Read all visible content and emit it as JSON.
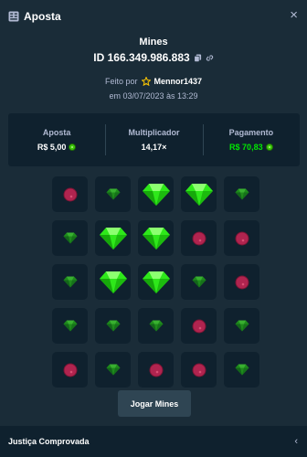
{
  "header": {
    "title": "Aposta",
    "close_label": "×"
  },
  "bet": {
    "game": "Mines",
    "id": "ID 166.349.986.883",
    "made_by_prefix": "Feito por",
    "user": "Mennor1437",
    "date": "em 03/07/2023 às 13:29"
  },
  "stats": {
    "bet_label": "Aposta",
    "bet_value": "R$ 5,00",
    "multiplier_label": "Multiplicador",
    "multiplier_value": "14,17×",
    "payout_label": "Pagamento",
    "payout_value": "R$ 70,83"
  },
  "colors": {
    "accent_green": "#00e701",
    "bg": "#1a2c38",
    "panel": "#0f212e",
    "mine": "#b0244f"
  },
  "board": [
    [
      "mine",
      "gem",
      "gem-big",
      "gem-big",
      "gem"
    ],
    [
      "gem",
      "gem-big",
      "gem-big",
      "mine",
      "mine"
    ],
    [
      "gem",
      "gem-big",
      "gem-big",
      "gem",
      "mine"
    ],
    [
      "gem",
      "gem",
      "gem",
      "mine",
      "gem"
    ],
    [
      "mine",
      "gem",
      "mine",
      "mine",
      "gem"
    ]
  ],
  "play_button": "Jogar Mines",
  "footer": {
    "label": "Justiça Comprovada",
    "chevron": "‹"
  }
}
